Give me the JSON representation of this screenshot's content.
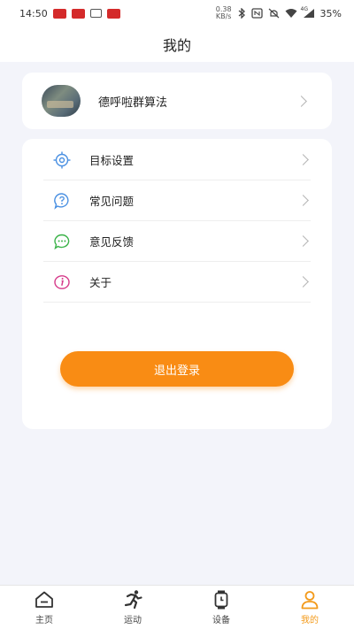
{
  "status_bar": {
    "time": "14:50",
    "speed": "0.38",
    "speed_unit": "KB/s",
    "signal_label": "4G",
    "battery": "35%"
  },
  "header": {
    "title": "我的"
  },
  "profile": {
    "name": "德呼啦群算法"
  },
  "menu": {
    "items": [
      {
        "label": "目标设置",
        "icon": "target-icon",
        "color": "#4a90e2"
      },
      {
        "label": "常见问题",
        "icon": "question-icon",
        "color": "#4a90e2"
      },
      {
        "label": "意见反馈",
        "icon": "chat-icon",
        "color": "#3cb34a"
      },
      {
        "label": "关于",
        "icon": "info-icon",
        "color": "#d63a8a"
      }
    ]
  },
  "logout": {
    "label": "退出登录",
    "color": "#f98c14"
  },
  "tabbar": {
    "active_color": "#f39a1a",
    "items": [
      {
        "label": "主页",
        "icon": "home-icon"
      },
      {
        "label": "运动",
        "icon": "run-icon"
      },
      {
        "label": "设备",
        "icon": "watch-icon"
      },
      {
        "label": "我的",
        "icon": "user-icon",
        "active": true
      }
    ]
  }
}
